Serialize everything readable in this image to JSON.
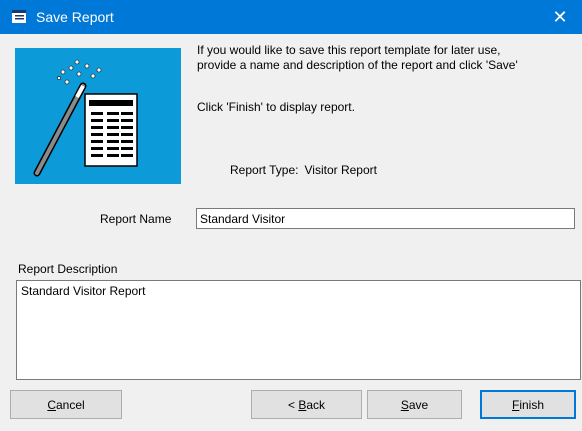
{
  "window": {
    "title": "Save Report",
    "close_glyph": "✕"
  },
  "intro": {
    "line1": "If you would like to save this report template for later use,",
    "line2": "provide a name and description of the report and click 'Save'",
    "finish_note": "Click 'Finish' to display report."
  },
  "report_type": {
    "label": "Report Type:",
    "value": "Visitor Report"
  },
  "report_name": {
    "label": "Report Name",
    "value": "Standard Visitor"
  },
  "report_description": {
    "label": "Report Description",
    "value": "Standard Visitor Report"
  },
  "buttons": {
    "cancel": {
      "accel": "C",
      "rest": "ancel"
    },
    "back": {
      "prefix": "< ",
      "accel": "B",
      "rest": "ack"
    },
    "save": {
      "accel": "S",
      "rest": "ave"
    },
    "finish": {
      "accel": "F",
      "rest": "inish"
    }
  },
  "colors": {
    "titlebar": "#0078d7",
    "wizard_background": "#0c9ad8",
    "dialog_background": "#f0f0f0"
  },
  "icons": {
    "title_icon": "report-window-icon",
    "wizard_image": "magic-wand-report-icon"
  }
}
